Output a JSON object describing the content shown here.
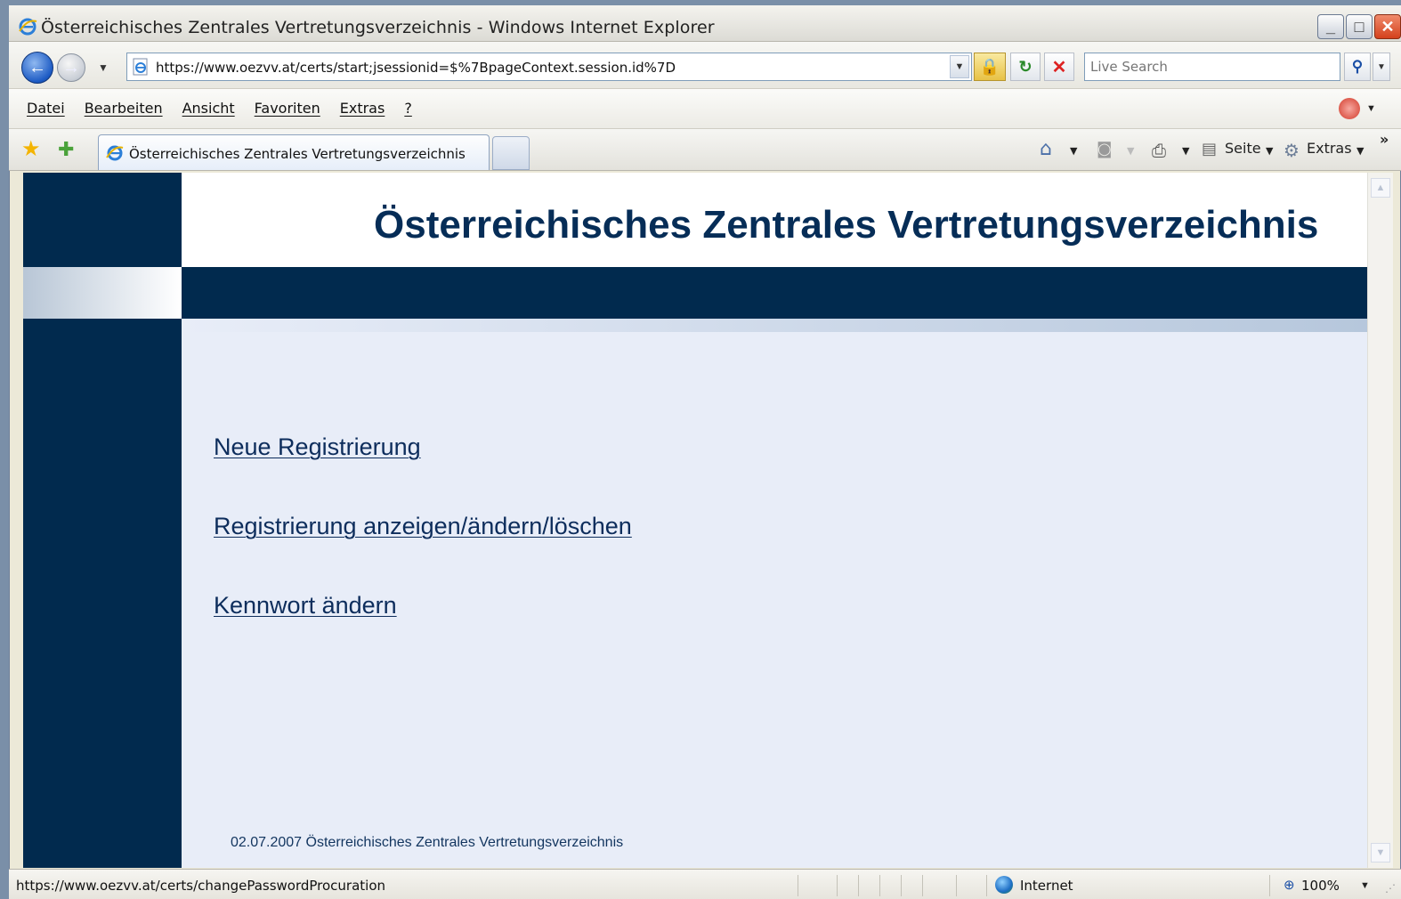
{
  "window": {
    "title": "Österreichisches Zentrales Vertretungsverzeichnis - Windows Internet Explorer"
  },
  "addressbar": {
    "url": "https://www.oezvv.at/certs/start;jsessionid=$%7BpageContext.session.id%7D",
    "search_placeholder": "Live Search"
  },
  "menu": {
    "items": [
      {
        "label": "Datei"
      },
      {
        "label": "Bearbeiten"
      },
      {
        "label": "Ansicht"
      },
      {
        "label": "Favoriten"
      },
      {
        "label": "Extras"
      },
      {
        "label": "?"
      }
    ]
  },
  "tabs": {
    "active_label": "Österreichisches Zentrales Vertretungsverzeichnis"
  },
  "commandbar": {
    "page_label": "Seite",
    "tools_label": "Extras"
  },
  "page": {
    "title": "Österreichisches Zentrales Vertretungsverzeichnis",
    "links": [
      {
        "label": "Neue Registrierung"
      },
      {
        "label": "Registrierung anzeigen/ändern/löschen"
      },
      {
        "label": "Kennwort ändern"
      }
    ],
    "footer": "02.07.2007 Österreichisches Zentrales Vertretungsverzeichnis"
  },
  "statusbar": {
    "text": "https://www.oezvv.at/certs/changePasswordProcuration",
    "zone": "Internet",
    "zoom": "100%"
  },
  "colors": {
    "dark_navy": "#012a4e",
    "content_bg": "#e8edf8",
    "link": "#0d2d5c"
  }
}
